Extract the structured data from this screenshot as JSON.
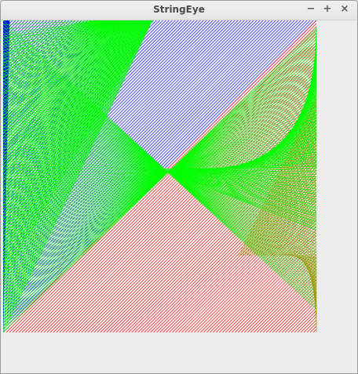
{
  "window": {
    "title": "StringEye"
  },
  "controls": {
    "minimize": "−",
    "maximize": "+",
    "close": "×"
  },
  "colors": {
    "background": "#ededed",
    "blue": "#0000ff",
    "green": "#00ff00",
    "red": "#ff0000",
    "olive": "#999900"
  }
}
